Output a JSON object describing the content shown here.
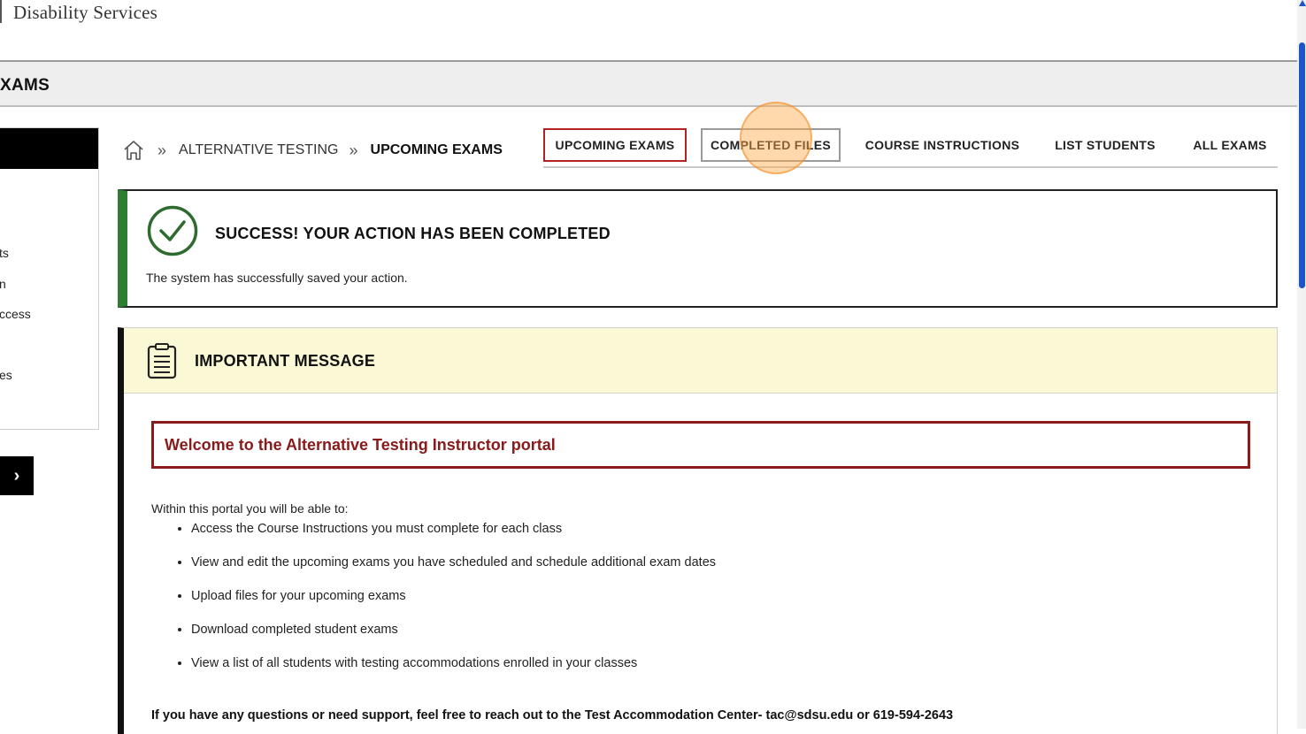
{
  "header": {
    "brand": "Disability Services"
  },
  "section": {
    "title": "XAMS"
  },
  "sidebar": {
    "items": [
      {
        "label": "ts"
      },
      {
        "label": "n"
      },
      {
        "label": "ccess"
      },
      {
        "label": "es"
      }
    ],
    "next_label": "›"
  },
  "breadcrumb": {
    "sep1": "»",
    "link": "ALTERNATIVE TESTING",
    "sep2": "»",
    "current": "UPCOMING EXAMS"
  },
  "tabs": [
    {
      "label": "UPCOMING EXAMS"
    },
    {
      "label": "COMPLETED FILES"
    },
    {
      "label": "COURSE INSTRUCTIONS"
    },
    {
      "label": "LIST STUDENTS"
    },
    {
      "label": "ALL EXAMS"
    }
  ],
  "success": {
    "title": "SUCCESS! YOUR ACTION HAS BEEN COMPLETED",
    "text": "The system has successfully saved your action."
  },
  "important": {
    "title": "IMPORTANT MESSAGE",
    "welcome": "Welcome to the Alternative Testing Instructor portal",
    "intro": "Within this portal you will be able to:",
    "bullets": [
      "Access the Course Instructions you must complete for each class",
      "View and edit the upcoming exams you have scheduled and schedule additional exam dates",
      "Upload files for your upcoming exams",
      "Download completed student exams",
      "View a list of all students with testing accommodations enrolled in your classes"
    ],
    "support": "If you have any questions or need support, feel free to reach out to the Test Accommodation Center- tac@sdsu.edu or 619-594-2643"
  },
  "colors": {
    "success_green": "#2e7d32",
    "accent_red": "#8b1a1a",
    "active_tab_border": "#b22222",
    "notice_yellow": "#fbf8d6",
    "scrollbar_blue": "#1a56c9"
  },
  "icons": [
    "home-icon",
    "check-circle-icon",
    "clipboard-icon",
    "chevron-right-icon"
  ]
}
